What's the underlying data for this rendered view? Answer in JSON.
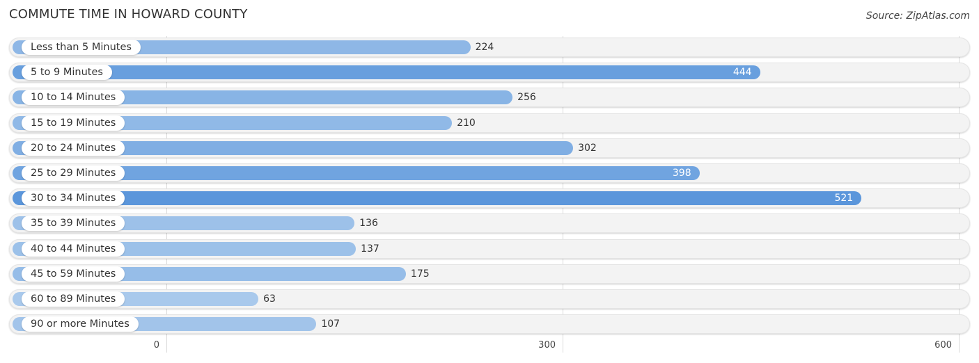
{
  "header": {
    "title": "COMMUTE TIME IN HOWARD COUNTY",
    "source": "Source: ZipAtlas.com"
  },
  "chart_data": {
    "type": "bar",
    "orientation": "horizontal",
    "title": "COMMUTE TIME IN HOWARD COUNTY",
    "xlabel": "",
    "ylabel": "",
    "xlim": [
      0,
      600
    ],
    "ticks": [
      0,
      300,
      600
    ],
    "tick_labels": [
      "0",
      "300",
      "600"
    ],
    "grid": true,
    "categories": [
      "Less than 5 Minutes",
      "5 to 9 Minutes",
      "10 to 14 Minutes",
      "15 to 19 Minutes",
      "20 to 24 Minutes",
      "25 to 29 Minutes",
      "30 to 34 Minutes",
      "35 to 39 Minutes",
      "40 to 44 Minutes",
      "45 to 59 Minutes",
      "60 to 89 Minutes",
      "90 or more Minutes"
    ],
    "values": [
      224,
      444,
      256,
      210,
      302,
      398,
      521,
      136,
      137,
      175,
      63,
      107
    ],
    "colors": {
      "max": "#5b96db",
      "min": "#a9c9ec"
    }
  }
}
